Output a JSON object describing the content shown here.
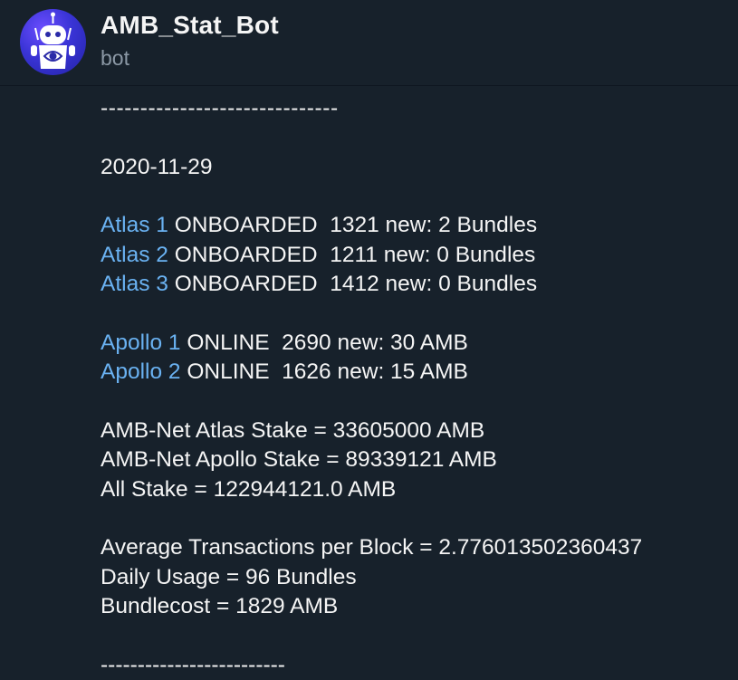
{
  "chat": {
    "title": "AMB_Stat_Bot",
    "status": "bot"
  },
  "message": {
    "divider_top": "------------------------------",
    "date": "2020-11-29",
    "atlas": [
      {
        "link": "Atlas 1",
        "text": " ONBOARDED  1321 new: 2 Bundles"
      },
      {
        "link": "Atlas 2",
        "text": " ONBOARDED  1211 new: 0 Bundles"
      },
      {
        "link": "Atlas 3",
        "text": " ONBOARDED  1412 new: 0 Bundles"
      }
    ],
    "apollo": [
      {
        "link": "Apollo 1",
        "text": " ONLINE  2690 new: 30 AMB"
      },
      {
        "link": "Apollo 2",
        "text": " ONLINE  1626 new: 15 AMB"
      }
    ],
    "stake": {
      "atlas": "AMB-Net Atlas Stake = 33605000 AMB",
      "apollo": "AMB-Net Apollo Stake = 89339121 AMB",
      "all": "All Stake = 122944121.0 AMB"
    },
    "usage": {
      "avg_tx": "Average Transactions per Block = 2.776013502360437",
      "daily": "Daily Usage = 96 Bundles",
      "bundlecost": "Bundlecost = 1829 AMB"
    },
    "divider_bottom": "-------------------------"
  },
  "colors": {
    "background": "#17212b",
    "link": "#6ab2f2",
    "text": "#f5f5f5",
    "muted": "#8b98a5",
    "avatar": "#3a34d6"
  },
  "icons": {
    "avatar": "robot-icon"
  }
}
